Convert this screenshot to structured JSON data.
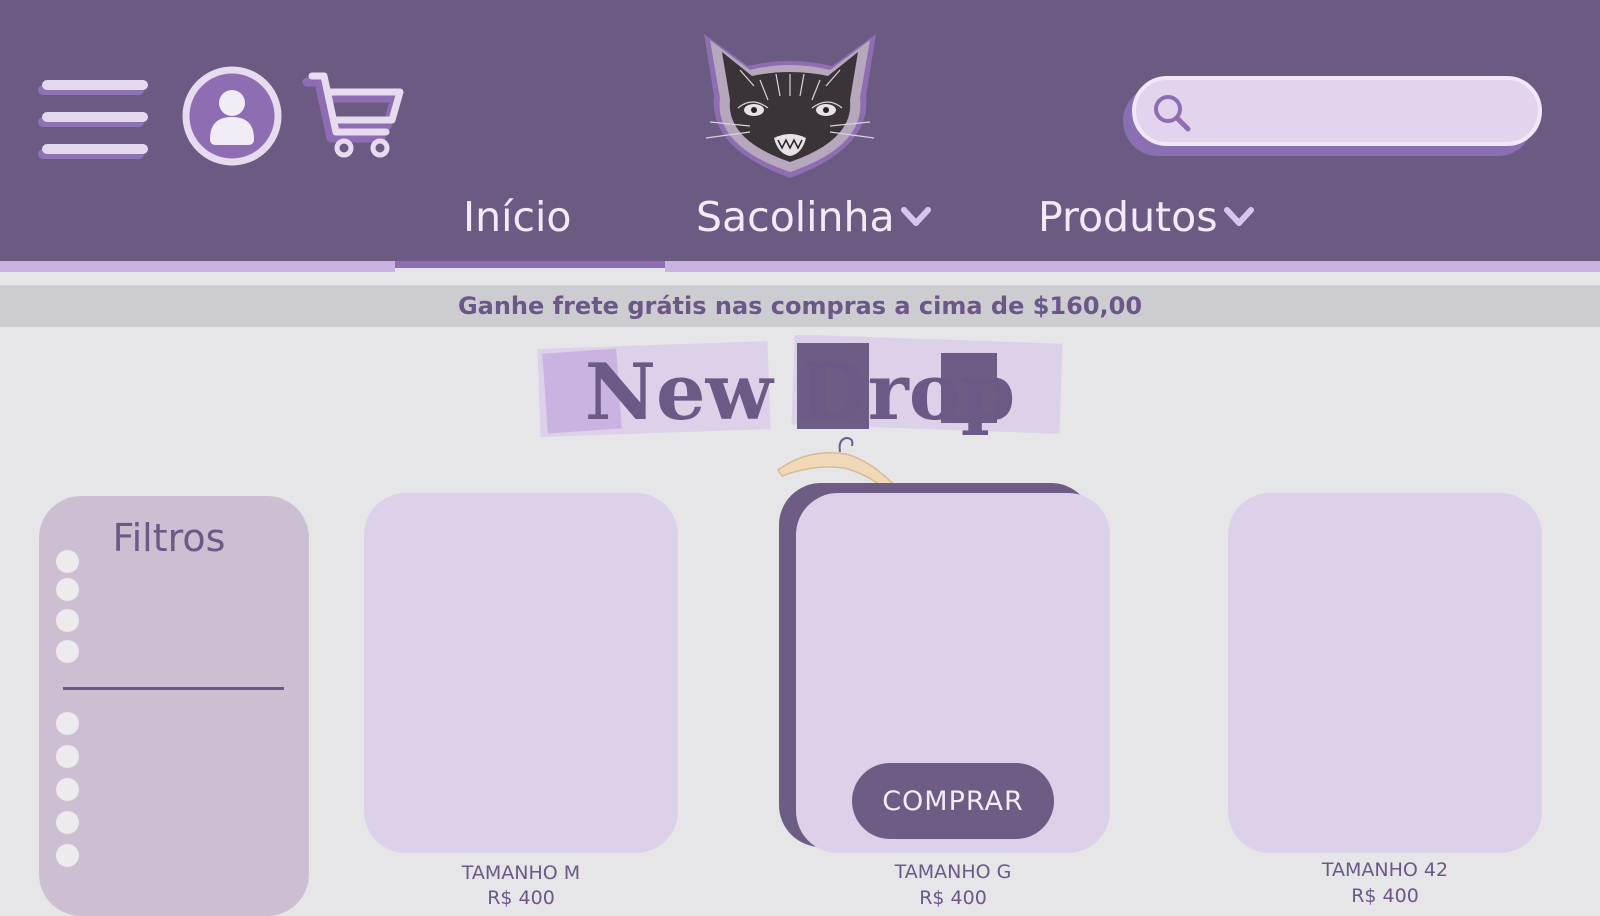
{
  "header": {
    "nav": [
      {
        "label": "Início",
        "has_dropdown": false,
        "active": true
      },
      {
        "label": "Sacolinha",
        "has_dropdown": true,
        "active": false
      },
      {
        "label": "Produtos",
        "has_dropdown": true,
        "active": false
      }
    ],
    "search": {
      "value": "",
      "placeholder": ""
    },
    "icons": {
      "menu": "hamburger-menu-icon",
      "user": "user-icon",
      "cart": "cart-icon",
      "search": "search-icon",
      "logo": "cat-logo"
    }
  },
  "promo": {
    "text": "Ganhe frete grátis nas compras a cima de $160,00"
  },
  "banner": {
    "title": "New Drop"
  },
  "filters": {
    "title": "Filtros",
    "group1_count": 4,
    "group2_count": 5
  },
  "products": [
    {
      "label": "TAMANHO M",
      "price": "R$ 400"
    },
    {
      "label": "TAMANHO G",
      "price": "R$ 400",
      "button": "COMPRAR"
    },
    {
      "label": "TAMANHO 42",
      "price": "R$ 400"
    }
  ],
  "colors": {
    "header": "#6b5b83",
    "accent": "#8f6db2",
    "card": "#ddd0e9",
    "sidebar": "#ccbfd2",
    "button": "#6d5c84",
    "background": "#e6e5e7"
  }
}
